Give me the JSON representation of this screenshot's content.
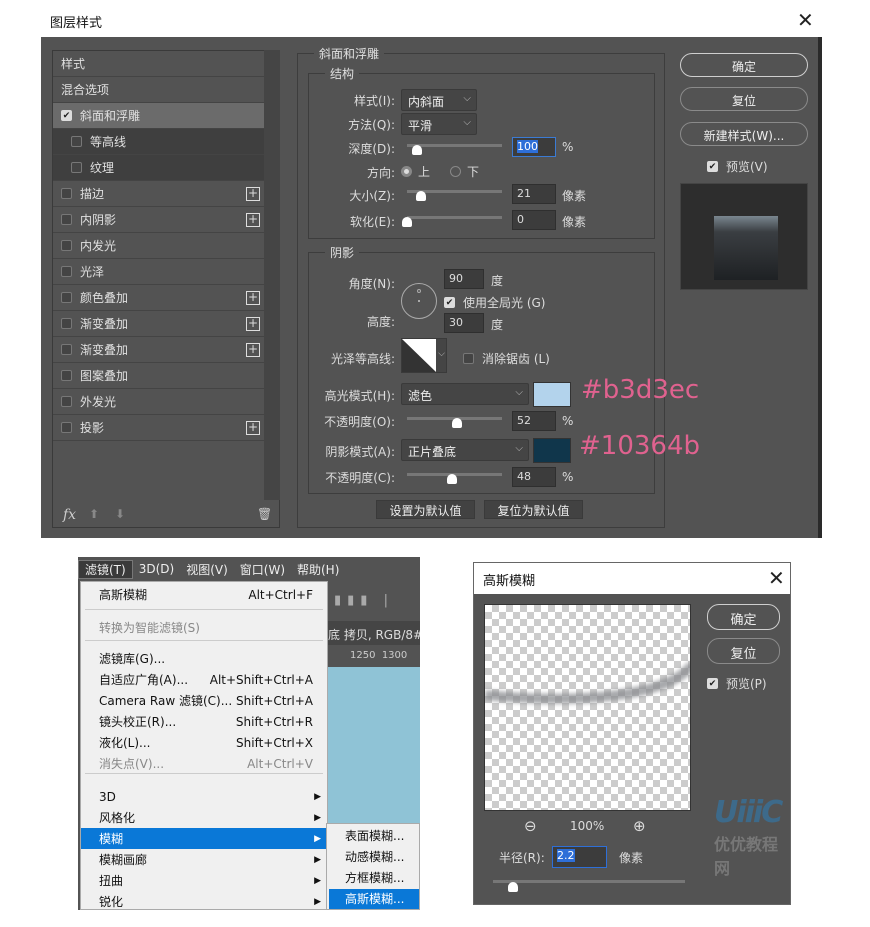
{
  "layer_style": {
    "title": "图层样式",
    "list": {
      "header": "样式",
      "blend": "混合选项",
      "items": [
        {
          "label": "斜面和浮雕",
          "checked": true,
          "plus": false
        },
        {
          "label": "等高线",
          "checked": false,
          "plus": false
        },
        {
          "label": "纹理",
          "checked": false,
          "plus": false
        },
        {
          "label": "描边",
          "checked": false,
          "plus": true
        },
        {
          "label": "内阴影",
          "checked": false,
          "plus": true
        },
        {
          "label": "内发光",
          "checked": false,
          "plus": false
        },
        {
          "label": "光泽",
          "checked": false,
          "plus": false
        },
        {
          "label": "颜色叠加",
          "checked": false,
          "plus": true
        },
        {
          "label": "渐变叠加",
          "checked": false,
          "plus": true
        },
        {
          "label": "渐变叠加",
          "checked": false,
          "plus": true
        },
        {
          "label": "图案叠加",
          "checked": false,
          "plus": false
        },
        {
          "label": "外发光",
          "checked": false,
          "plus": false
        },
        {
          "label": "投影",
          "checked": false,
          "plus": true
        }
      ],
      "fx": "fx"
    },
    "bevel": {
      "title": "斜面和浮雕",
      "structure": {
        "title": "结构",
        "style_label": "样式(I):",
        "style_value": "内斜面",
        "method_label": "方法(Q):",
        "method_value": "平滑",
        "depth_label": "深度(D):",
        "depth_value": "100",
        "depth_unit": "%",
        "direction_label": "方向:",
        "dir_up": "上",
        "dir_down": "下",
        "size_label": "大小(Z):",
        "size_value": "21",
        "size_unit": "像素",
        "soften_label": "软化(E):",
        "soften_value": "0",
        "soften_unit": "像素"
      },
      "shading": {
        "title": "阴影",
        "angle_label": "角度(N):",
        "angle_value": "90",
        "angle_unit": "度",
        "global_light": "使用全局光 (G)",
        "altitude_label": "高度:",
        "altitude_value": "30",
        "altitude_unit": "度",
        "gloss_label": "光泽等高线:",
        "antialias": "消除锯齿 (L)",
        "highlight_label": "高光模式(H):",
        "highlight_mode": "滤色",
        "highlight_color": "#b3d3ec",
        "highlight_hex": "#b3d3ec",
        "hl_opacity_label": "不透明度(O):",
        "hl_opacity": "52",
        "hl_unit": "%",
        "shadow_label": "阴影模式(A):",
        "shadow_mode": "正片叠底",
        "shadow_color": "#10364b",
        "shadow_hex": "#10364b",
        "sh_opacity_label": "不透明度(C):",
        "sh_opacity": "48",
        "sh_unit": "%"
      },
      "set_default": "设置为默认值",
      "reset_default": "复位为默认值"
    },
    "buttons": {
      "ok": "确定",
      "reset": "复位",
      "new_style": "新建样式(W)...",
      "preview": "预览(V)"
    }
  },
  "filter_menu": {
    "menubar": [
      "滤镜(T)",
      "3D(D)",
      "视图(V)",
      "窗口(W)",
      "帮助(H)"
    ],
    "doc_title": "底 拷贝, RGB/8#",
    "ruler": [
      "1250",
      "1300"
    ],
    "items": [
      {
        "label": "高斯模糊",
        "shortcut": "Alt+Ctrl+F"
      },
      {
        "label": "转换为智能滤镜(S)",
        "shortcut": ""
      },
      {
        "label": "滤镜库(G)...",
        "shortcut": ""
      },
      {
        "label": "自适应广角(A)...",
        "shortcut": "Alt+Shift+Ctrl+A"
      },
      {
        "label": "Camera Raw 滤镜(C)...",
        "shortcut": "Shift+Ctrl+A"
      },
      {
        "label": "镜头校正(R)...",
        "shortcut": "Shift+Ctrl+R"
      },
      {
        "label": "液化(L)...",
        "shortcut": "Shift+Ctrl+X"
      },
      {
        "label": "消失点(V)...",
        "shortcut": "Alt+Ctrl+V"
      },
      {
        "label": "3D",
        "shortcut": ""
      },
      {
        "label": "风格化",
        "shortcut": ""
      },
      {
        "label": "模糊",
        "shortcut": ""
      },
      {
        "label": "模糊画廊",
        "shortcut": ""
      },
      {
        "label": "扭曲",
        "shortcut": ""
      },
      {
        "label": "锐化",
        "shortcut": ""
      }
    ],
    "submenu": [
      "表面模糊...",
      "动感模糊...",
      "方框模糊...",
      "高斯模糊..."
    ]
  },
  "gaussian": {
    "title": "高斯模糊",
    "ok": "确定",
    "reset": "复位",
    "preview": "预览(P)",
    "zoom": "100%",
    "radius_label": "半径(R):",
    "radius_value": "2.2",
    "radius_unit": "像素",
    "watermark": "优优教程网"
  }
}
